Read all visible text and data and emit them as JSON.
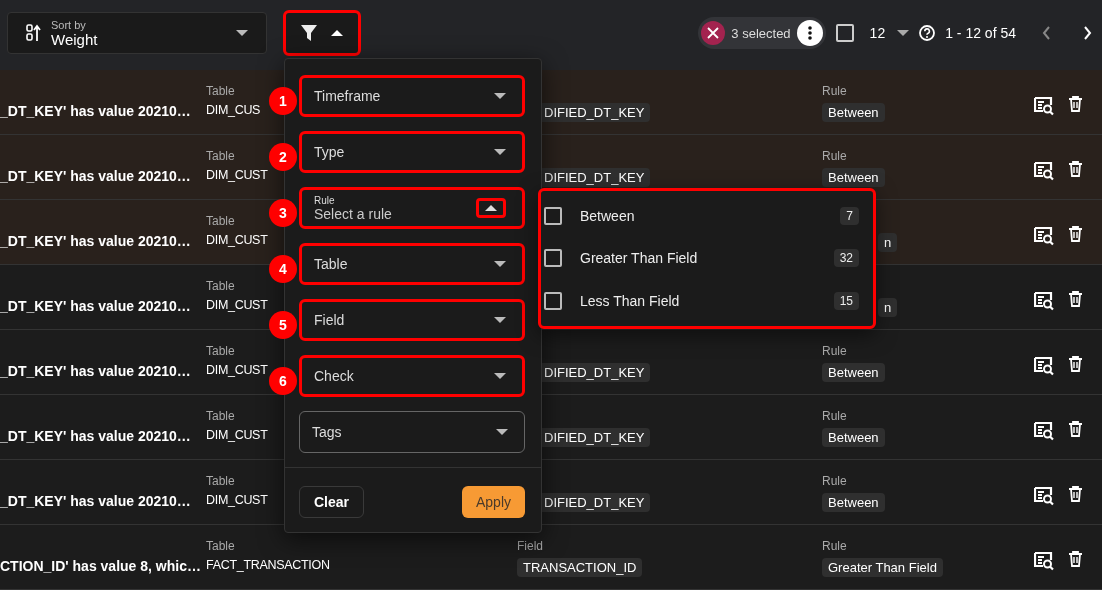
{
  "toolbar": {
    "sort": {
      "label": "Sort by",
      "value": "Weight"
    },
    "filter_button": {
      "expanded": true,
      "highlighted": true
    },
    "selection": {
      "count_text": "3 selected"
    },
    "select_all": {
      "checked": false
    },
    "page_size": "12",
    "pagination": "1 - 12 of 54"
  },
  "rows": [
    {
      "selected": true,
      "message": "_DT_KEY' has value 20210…",
      "table_label": "Table",
      "table": "DIM_CUS",
      "field": "DIFIED_DT_KEY",
      "rule_label": "Rule",
      "rule": "Between"
    },
    {
      "selected": true,
      "message": "_DT_KEY' has value 20210…",
      "table_label": "Table",
      "table": "DIM_CUST",
      "field": "DIFIED_DT_KEY",
      "rule_label": "Rule",
      "rule": "Between"
    },
    {
      "selected": true,
      "message": "_DT_KEY' has value 20210…",
      "table_label": "Table",
      "table": "DIM_CUST",
      "rule": "n"
    },
    {
      "selected": false,
      "message": "_DT_KEY' has value 20210…",
      "table_label": "Table",
      "table": "DIM_CUST",
      "rule": "n"
    },
    {
      "selected": false,
      "message": "_DT_KEY' has value 20210…",
      "table_label": "Table",
      "table": "DIM_CUST",
      "field": "DIFIED_DT_KEY",
      "rule_label": "Rule",
      "rule": "Between"
    },
    {
      "selected": false,
      "message": "_DT_KEY' has value 20210…",
      "table_label": "Table",
      "table": "DIM_CUST",
      "field": "DIFIED_DT_KEY",
      "rule_label": "Rule",
      "rule": "Between"
    },
    {
      "selected": false,
      "message": "_DT_KEY' has value 20210…",
      "table_label": "Table",
      "table": "DIM_CUST",
      "field": "DIFIED_DT_KEY",
      "rule_label": "Rule",
      "rule": "Between"
    },
    {
      "selected": false,
      "message": "CTION_ID' has value 8, whic…",
      "table_label": "Table",
      "table": "FACT_TRANSACTION",
      "field_label": "Field",
      "field": "TRANSACTION_ID",
      "rule_label": "Rule",
      "rule": "Greater Than Field"
    }
  ],
  "filter_panel": {
    "fields": [
      {
        "kind": "select",
        "number": "1",
        "label": "Timeframe",
        "highlighted": true
      },
      {
        "kind": "select",
        "number": "2",
        "label": "Type",
        "highlighted": true
      },
      {
        "kind": "open_select",
        "number": "3",
        "label": "Rule",
        "placeholder": "Select a rule",
        "highlighted": true,
        "caret_highlighted": true
      },
      {
        "kind": "select",
        "number": "4",
        "label": "Table",
        "highlighted": true
      },
      {
        "kind": "select",
        "number": "5",
        "label": "Field",
        "highlighted": true
      },
      {
        "kind": "select",
        "number": "6",
        "label": "Check",
        "highlighted": true
      },
      {
        "kind": "select",
        "label": "Tags",
        "highlighted": false
      }
    ],
    "buttons": [
      {
        "kind": "secondary",
        "label": "Clear"
      },
      {
        "kind": "primary",
        "label": "Apply"
      }
    ]
  },
  "rule_options": {
    "highlighted": true,
    "items": [
      {
        "label": "Between",
        "count": "7",
        "checked": false
      },
      {
        "label": "Greater Than Field",
        "count": "32",
        "checked": false
      },
      {
        "label": "Less Than Field",
        "count": "15",
        "checked": false
      }
    ]
  }
}
